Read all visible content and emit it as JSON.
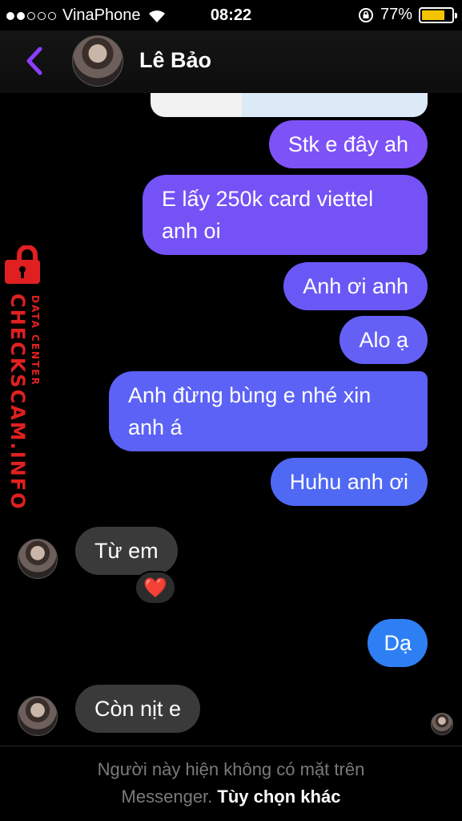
{
  "status_bar": {
    "carrier": "VinaPhone",
    "time": "08:22",
    "battery_percent": "77%",
    "battery_level": 0.77,
    "battery_color": "#f5c400"
  },
  "header": {
    "contact_name": "Lê Bảo",
    "back_icon": "chevron-left-icon",
    "accent_color": "#8a3ffc"
  },
  "messages": [
    {
      "from": "me",
      "text": "Stk e đây ah"
    },
    {
      "from": "me",
      "text": "E lấy 250k card viettel anh oi"
    },
    {
      "from": "me",
      "text": "Anh ơi anh"
    },
    {
      "from": "me",
      "text": "Alo ạ"
    },
    {
      "from": "me",
      "text": "Anh đừng bùng e nhé xin anh á"
    },
    {
      "from": "me",
      "text": "Huhu anh ơi"
    },
    {
      "from": "them",
      "text": "Từ em",
      "reaction": "❤️"
    },
    {
      "from": "me",
      "text": "Dạ"
    },
    {
      "from": "them",
      "text": "Còn nịt e"
    }
  ],
  "watermark": {
    "main": "CHECKSCAM.INFO",
    "sub": "DATA CENTER",
    "color": "#e02020"
  },
  "footer": {
    "notice": "Người này hiện không có mặt trên Messenger.",
    "notice_line1": "Người này hiện không có mặt trên",
    "notice_line2": "Messenger.",
    "link": "Tùy chọn khác"
  }
}
